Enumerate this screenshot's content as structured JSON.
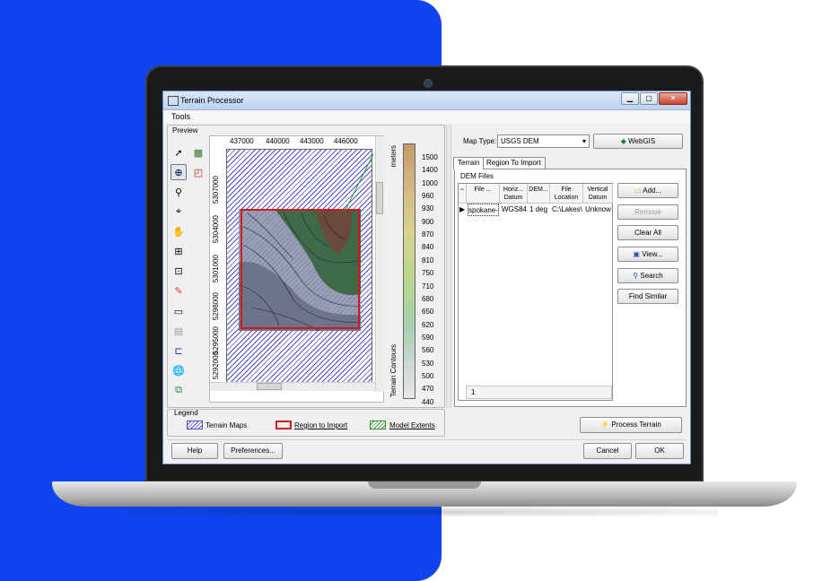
{
  "window": {
    "title": "Terrain Processor",
    "menu_tools": "Tools",
    "win_minimize": "▁",
    "win_restore": "▢",
    "win_close": "✕"
  },
  "preview": {
    "label": "Preview",
    "x_ticks": [
      "437000",
      "440000",
      "443000",
      "446000"
    ],
    "y_ticks": [
      "5307000",
      "5304000",
      "5301000",
      "5298000",
      "5295000",
      "5292000"
    ],
    "scale_title": "meters",
    "scale_axis": "Terrain Contours",
    "scale_values": [
      "1500",
      "1400",
      "1000",
      "960",
      "930",
      "900",
      "870",
      "840",
      "810",
      "750",
      "710",
      "680",
      "650",
      "620",
      "590",
      "560",
      "530",
      "500",
      "470",
      "440"
    ]
  },
  "legend": {
    "label": "Legend",
    "terrain_maps": "Terrain Maps",
    "region_to_import": "Region to Import",
    "model_extents": "Model Extents",
    "colors": {
      "terrain": "#4a4fd0",
      "region": "#d01818",
      "extents": "#2a9a2a"
    }
  },
  "right": {
    "map_type_label": "Map Type:",
    "map_type_value": "USGS DEM",
    "webgis_button": "WebGIS",
    "tabs": {
      "terrain": "Terrain",
      "region": "Region To Import"
    },
    "dem_files_label": "DEM Files",
    "columns": {
      "file": "File ...",
      "hdatum": "Horiz... Datum",
      "dem": "DEM...",
      "location": "File Location",
      "vdatum": "Vertical Datum"
    },
    "row": {
      "file": "spokane-",
      "hdatum": "WGS84",
      "dem": "1 deg",
      "location": "C:\\Lakes\\",
      "vdatum": "Unknow"
    },
    "row_count": "1",
    "add_button": "Add...",
    "remove_button": "Remove",
    "clear_all_button": "Clear All",
    "view_button": "View...",
    "search_button": "Search",
    "find_similar_button": "Find Similar",
    "process_terrain_button": "Process Terrain"
  },
  "footer": {
    "help": "Help",
    "preferences": "Preferences...",
    "cancel": "Cancel",
    "ok": "OK"
  }
}
